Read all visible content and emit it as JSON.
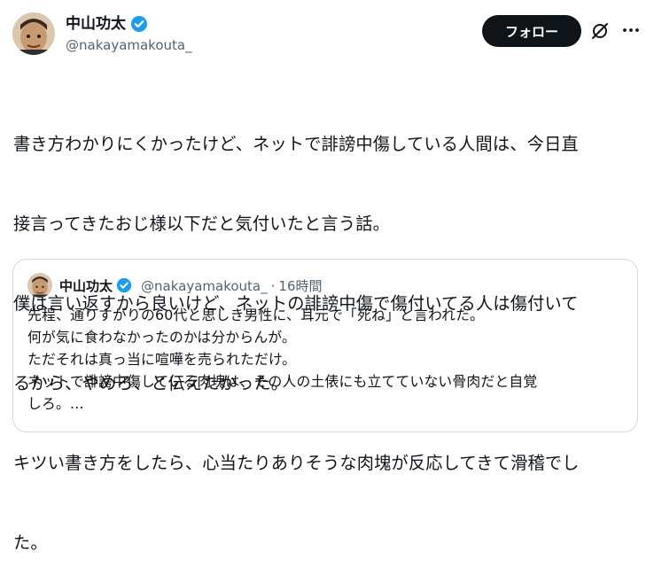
{
  "author": {
    "name": "中山功太",
    "handle": "@nakayamakouta_"
  },
  "follow_label": "フォロー",
  "tweet_lines": [
    "書き方わかりにくかったけど、ネットで誹謗中傷している人間は、今日直",
    "接言ってきたおじ様以下だと気付いたと言う話。",
    "僕は言い返すから良いけど、ネットの誹謗中傷で傷付いてる人は傷付いて",
    "るから、やめろ、と伝えたかった。",
    "キツい書き方をしたら、心当たりありそうな肉塊が反応してきて滑稽でし",
    "た。"
  ],
  "quote": {
    "name": "中山功太",
    "handle": "@nakayamakouta_",
    "separator": "·",
    "time": "16時間",
    "lines": [
      "先程、通りすがりの60代と思しき男性に、耳元で「死ね」と言われた。",
      "何が気に食わなかったのかは分からんが。",
      "ただそれは真っ当に喧嘩を売られただけ。",
      "ネットで誹謗中傷している肉塊は、その人の土俵にも立てていない骨肉だと自覚",
      "しろ。..."
    ]
  },
  "colors": {
    "verified": "#1d9bf0",
    "follow_bg": "#0f1419",
    "secondary_text": "#536471",
    "border": "#cfd9de"
  },
  "icons": {
    "verified": "verified-badge-icon",
    "grok": "grok-icon",
    "more": "more-icon"
  }
}
